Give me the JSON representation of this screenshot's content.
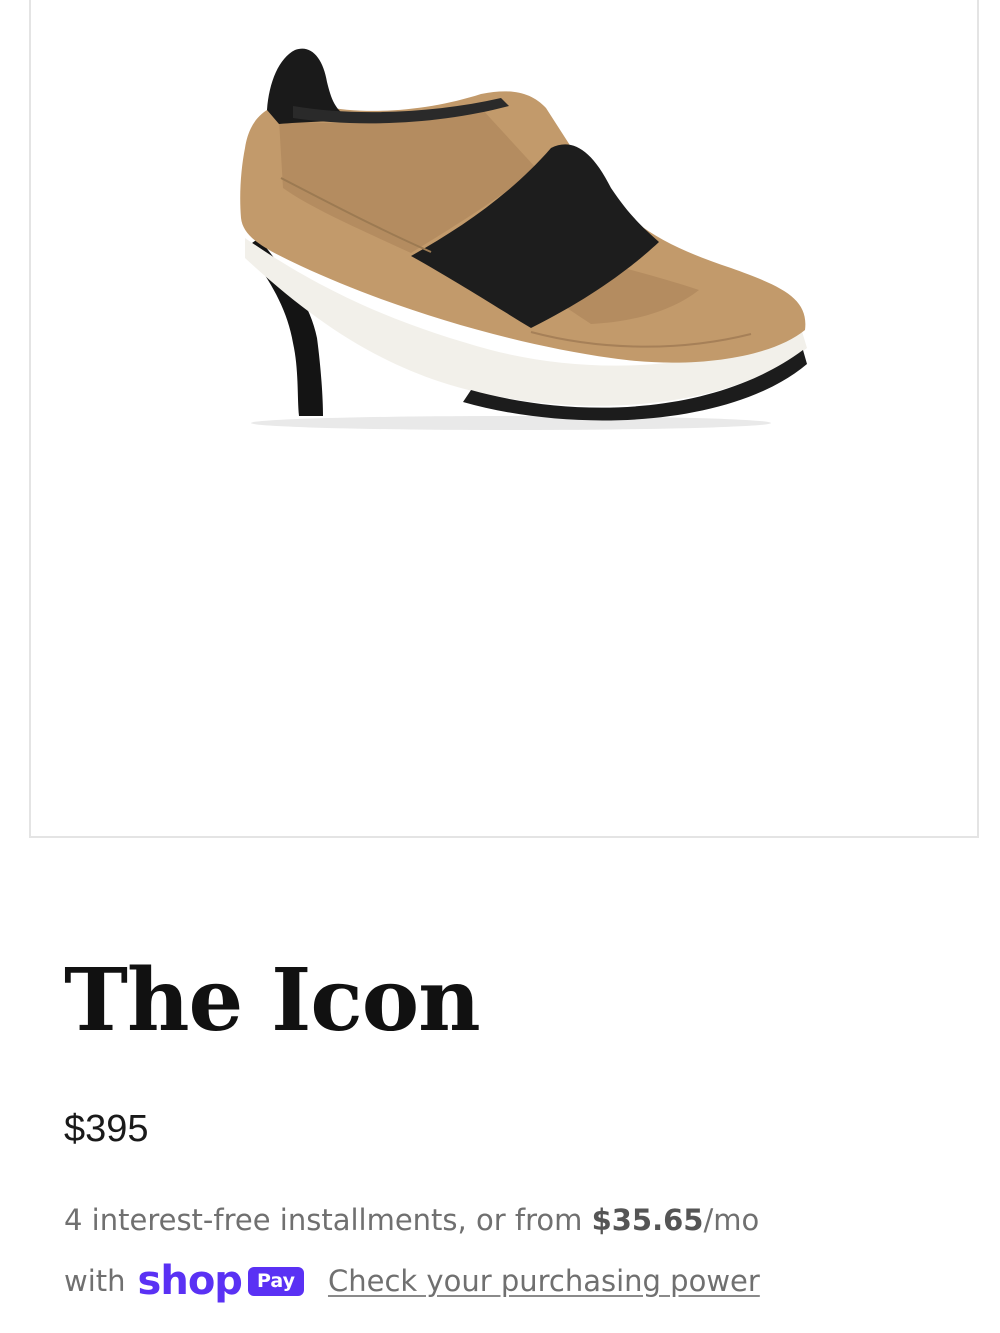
{
  "product": {
    "title": "The Icon",
    "price": "$395"
  },
  "installments": {
    "text_prefix": "4 interest-free installments, or from ",
    "amount": "$35.65",
    "text_suffix": "/mo",
    "with_label": "with",
    "shop_word": "shop",
    "pay_badge": "Pay",
    "link_label": "Check your purchasing power"
  },
  "colors": {
    "shop_pay_purple": "#5a31f4",
    "text_grey": "#707070",
    "title_black": "#111111"
  },
  "icons": {
    "product_image": "shoe-image",
    "shop_pay_logo": "shop-pay-logo"
  }
}
